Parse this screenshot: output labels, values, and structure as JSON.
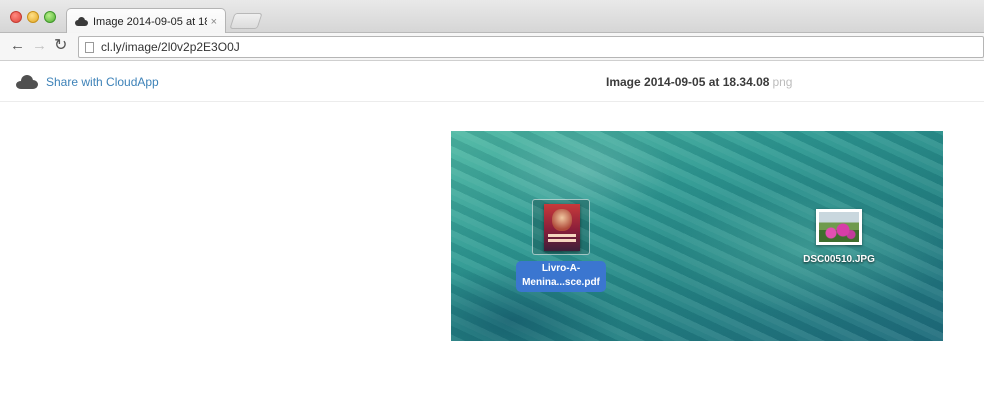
{
  "browser": {
    "tab": {
      "title": "Image 2014-09-05 at 18.",
      "close_glyph": "×",
      "icon": "cloud-icon"
    },
    "nav": {
      "back": "←",
      "forward": "→",
      "reload": "↻"
    },
    "url": "cl.ly/image/2l0v2p2E3O0J"
  },
  "header": {
    "share_label": "Share with CloudApp",
    "file_title": "Image 2014-09-05 at 18.34.08",
    "file_ext": "png",
    "logo_icon": "cloud-icon"
  },
  "preview": {
    "files": [
      {
        "name_line1": "Livro-A-",
        "name_line2": "Menina...sce.pdf",
        "icon": "pdf-document-icon",
        "selected": true
      },
      {
        "name": "DSC00510.JPG",
        "icon": "jpg-image-icon",
        "selected": false
      }
    ]
  },
  "colors": {
    "link": "#3d82b8",
    "selection": "#3b76d0",
    "wallpaper": "#2f9a93"
  }
}
